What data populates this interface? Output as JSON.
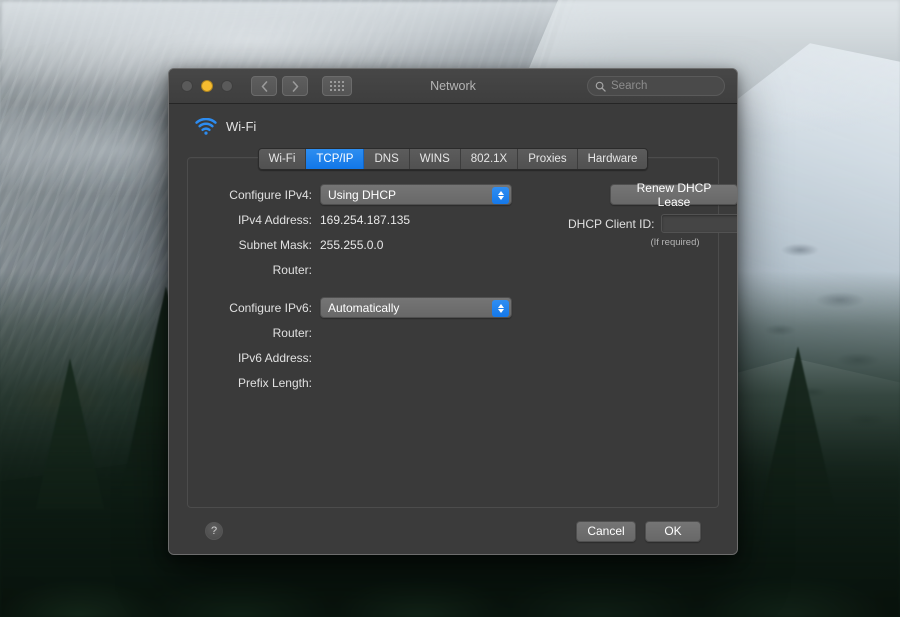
{
  "window": {
    "title": "Network",
    "traffic_lights": [
      {
        "name": "close",
        "color": "#5a5a5a"
      },
      {
        "name": "minimize",
        "color": "#f6bc2f"
      },
      {
        "name": "zoom",
        "color": "#5a5a5a"
      }
    ],
    "nav": {
      "back_icon": "chevron-left-icon",
      "forward_icon": "chevron-right-icon",
      "showall_icon": "grid-icon"
    },
    "search": {
      "placeholder": "Search",
      "value": "",
      "icon": "search-icon"
    }
  },
  "service": {
    "name": "Wi-Fi",
    "icon": "wifi-icon",
    "accent": "#2d8cf0"
  },
  "tabs": [
    {
      "label": "Wi-Fi",
      "active": false
    },
    {
      "label": "TCP/IP",
      "active": true
    },
    {
      "label": "DNS",
      "active": false
    },
    {
      "label": "WINS",
      "active": false
    },
    {
      "label": "802.1X",
      "active": false
    },
    {
      "label": "Proxies",
      "active": false
    },
    {
      "label": "Hardware",
      "active": false
    }
  ],
  "ipv4": {
    "configure_label": "Configure IPv4:",
    "configure_value": "Using DHCP",
    "address_label": "IPv4 Address:",
    "address_value": "169.254.187.135",
    "subnet_label": "Subnet Mask:",
    "subnet_value": "255.255.0.0",
    "router_label": "Router:",
    "router_value": "",
    "renew_button": "Renew DHCP Lease",
    "client_id_label": "DHCP Client ID:",
    "client_id_value": "",
    "client_id_hint": "(If required)"
  },
  "ipv6": {
    "configure_label": "Configure IPv6:",
    "configure_value": "Automatically",
    "router_label": "Router:",
    "router_value": "",
    "address_label": "IPv6 Address:",
    "address_value": "",
    "prefix_label": "Prefix Length:",
    "prefix_value": ""
  },
  "footer": {
    "help_label": "?",
    "cancel_label": "Cancel",
    "ok_label": "OK"
  }
}
